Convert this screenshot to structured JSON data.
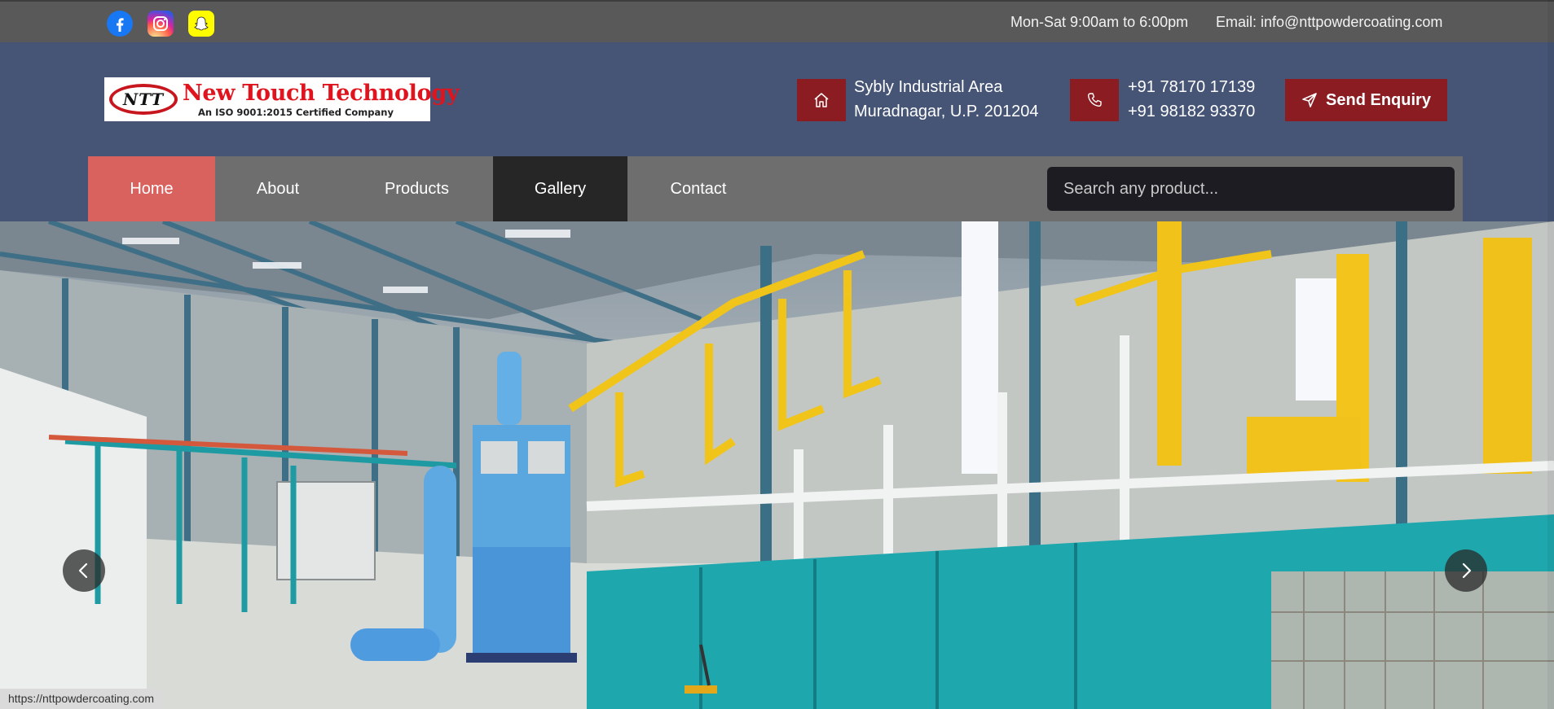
{
  "topbar": {
    "social": [
      "facebook-icon",
      "instagram-icon",
      "snapchat-icon"
    ],
    "hours": "Mon-Sat 9:00am to 6:00pm",
    "email": "Email: info@nttpowdercoating.com"
  },
  "header": {
    "logo": {
      "mark": "NTT",
      "name": "New Touch Technology",
      "tagline": "An ISO 9001:2015 Certified Company"
    },
    "address": {
      "icon": "home-icon",
      "line1": "Sybly Industrial Area",
      "line2": "Muradnagar, U.P. 201204"
    },
    "phone": {
      "icon": "phone-icon",
      "line1": "+91 78170 17139",
      "line2": "+91 98182 93370"
    },
    "enquiry_label": "Send Enquiry"
  },
  "nav": {
    "items": [
      {
        "label": "Home",
        "active": true
      },
      {
        "label": "About"
      },
      {
        "label": "Products"
      },
      {
        "label": "Gallery"
      },
      {
        "label": "Contact"
      }
    ],
    "search_placeholder": "Search any product..."
  },
  "hero": {
    "prev_icon": "chevron-left-icon",
    "next_icon": "chevron-right-icon"
  },
  "status_url": "https://nttpowdercoating.com",
  "colors": {
    "header_bg": "#465576",
    "accent_red": "#8b1d22",
    "nav_active": "#d9615e",
    "nav_bg": "#6e6e6e"
  }
}
